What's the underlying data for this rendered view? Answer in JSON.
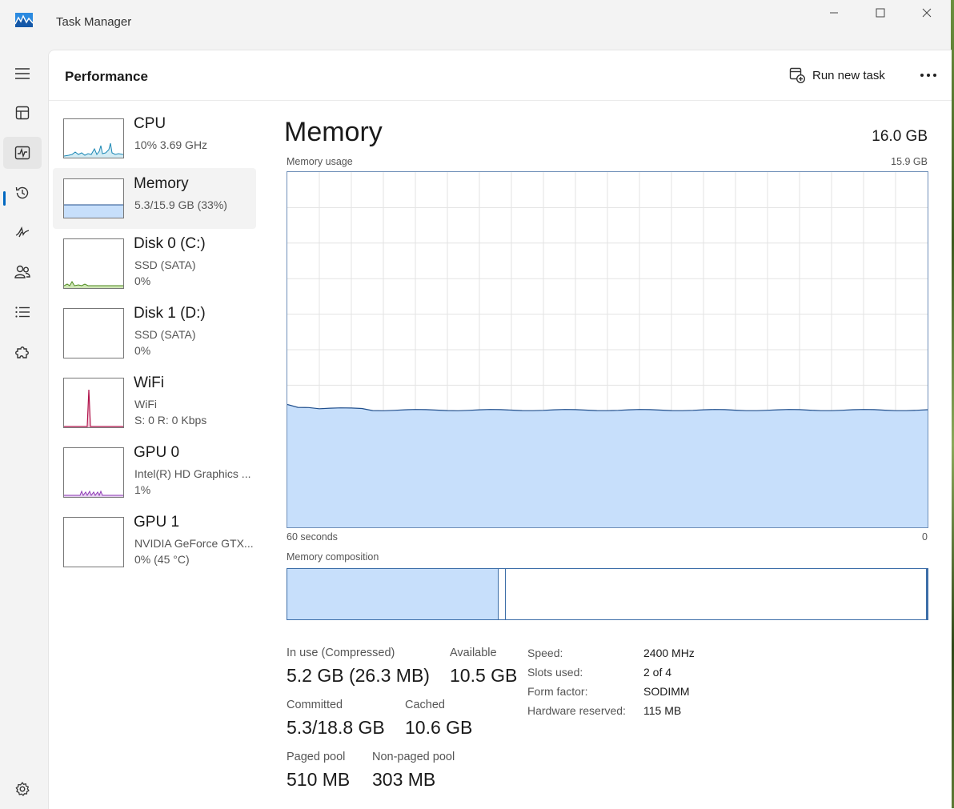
{
  "window": {
    "title": "Task Manager"
  },
  "nav": {
    "active": "performance"
  },
  "header": {
    "title": "Performance",
    "run_new_task": "Run new task",
    "more": "···"
  },
  "devices": [
    {
      "name": "CPU",
      "line1": "10%  3.69 GHz",
      "line2": ""
    },
    {
      "name": "Memory",
      "line1": "5.3/15.9 GB (33%)",
      "line2": ""
    },
    {
      "name": "Disk 0 (C:)",
      "line1": "SSD (SATA)",
      "line2": "0%"
    },
    {
      "name": "Disk 1 (D:)",
      "line1": "SSD (SATA)",
      "line2": "0%"
    },
    {
      "name": "WiFi",
      "line1": "WiFi",
      "line2": "S: 0 R: 0 Kbps"
    },
    {
      "name": "GPU 0",
      "line1": "Intel(R) HD Graphics ...",
      "line2": "1%"
    },
    {
      "name": "GPU 1",
      "line1": "NVIDIA GeForce GTX...",
      "line2": "0%  (45 °C)"
    }
  ],
  "detail": {
    "title": "Memory",
    "total": "16.0 GB",
    "usage_label": "Memory usage",
    "usage_max": "15.9 GB",
    "time_left": "60 seconds",
    "time_right": "0",
    "composition_label": "Memory composition",
    "usage_fraction": 0.33,
    "composition": {
      "in_use_fraction": 0.33,
      "modified_fraction": 0.01
    },
    "stats": {
      "in_use_label": "In use (Compressed)",
      "in_use": "5.2 GB (26.3 MB)",
      "available_label": "Available",
      "available": "10.5 GB",
      "committed_label": "Committed",
      "committed": "5.3/18.8 GB",
      "cached_label": "Cached",
      "cached": "10.6 GB",
      "paged_label": "Paged pool",
      "paged": "510 MB",
      "nonpaged_label": "Non-paged pool",
      "nonpaged": "303 MB"
    },
    "specs": [
      {
        "label": "Speed:",
        "value": "2400 MHz"
      },
      {
        "label": "Slots used:",
        "value": "2 of 4"
      },
      {
        "label": "Form factor:",
        "value": "SODIMM"
      },
      {
        "label": "Hardware reserved:",
        "value": "115 MB"
      }
    ]
  },
  "colors": {
    "accent": "#0067c0",
    "memory_fill": "#c7dffb",
    "memory_line": "#1f4e8c"
  }
}
